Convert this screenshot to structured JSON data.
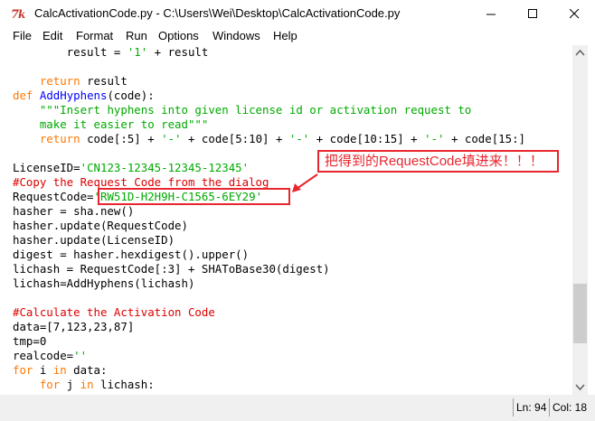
{
  "window": {
    "title": "CalcActivationCode.py - C:\\Users\\Wei\\Desktop\\CalcActivationCode.py",
    "app_icon": "python-idle-icon"
  },
  "menu": [
    {
      "label": "File"
    },
    {
      "label": "Edit"
    },
    {
      "label": "Format"
    },
    {
      "label": "Run"
    },
    {
      "label": "Options"
    },
    {
      "label": "Windows"
    },
    {
      "label": "Help"
    }
  ],
  "code": {
    "l1": {
      "a": "        result = ",
      "b": "'1'",
      "c": " + result"
    },
    "l3": {
      "a": "    ",
      "b": "return",
      "c": " result"
    },
    "l4": {
      "a": "def",
      "b": " ",
      "c": "AddHyphens",
      "d": "(code):"
    },
    "l5": {
      "a": "    ",
      "b": "\"\"\"Insert hyphens into given license id or activation request to"
    },
    "l6": {
      "a": "    ",
      "b": "make it easier to read\"\"\""
    },
    "l7": {
      "a": "    ",
      "b": "return",
      "c": " code[:5] + ",
      "d": "'-'",
      "e": " + code[5:10] + ",
      "f": "'-'",
      "g": " + code[10:15] + ",
      "h": "'-'",
      "i": " + code[15:]"
    },
    "l9": {
      "a": "LicenseID=",
      "b": "'CN123-12345-12345-12345'"
    },
    "l10": {
      "a": "#Copy the Request Code from the dialog"
    },
    "l11": {
      "a": "RequestCode=",
      "b": "'RW51D-H2H9H-C1565-6EY29'"
    },
    "l12": {
      "a": "hasher = sha.new()"
    },
    "l13": {
      "a": "hasher.update(RequestCode)"
    },
    "l14": {
      "a": "hasher.update(LicenseID)"
    },
    "l15": {
      "a": "digest = hasher.hexdigest().upper()"
    },
    "l16": {
      "a": "lichash = RequestCode[:3] + SHAToBase30(digest)"
    },
    "l17": {
      "a": "lichash=AddHyphens(lichash)"
    },
    "l19": {
      "a": "#Calculate the Activation Code"
    },
    "l20": {
      "a": "data=[7,123,23,87]"
    },
    "l21": {
      "a": "tmp=0"
    },
    "l22": {
      "a": "realcode=",
      "b": "''"
    },
    "l23": {
      "a": "for",
      "b": " i ",
      "c": "in",
      "d": " data:"
    },
    "l24": {
      "a": "    ",
      "b": "for",
      "c": " j ",
      "d": "in",
      "e": " lichash:"
    }
  },
  "annotation": {
    "text": "把得到的RequestCode填进来！！！",
    "color": "#e8262e"
  },
  "status": {
    "line": "Ln: 94",
    "col": "Col: 18"
  },
  "colors": {
    "keyword": "#ff7700",
    "builtin": "#900090",
    "string": "#00aa00",
    "comment": "#dd0000",
    "definition": "#0000ff"
  }
}
